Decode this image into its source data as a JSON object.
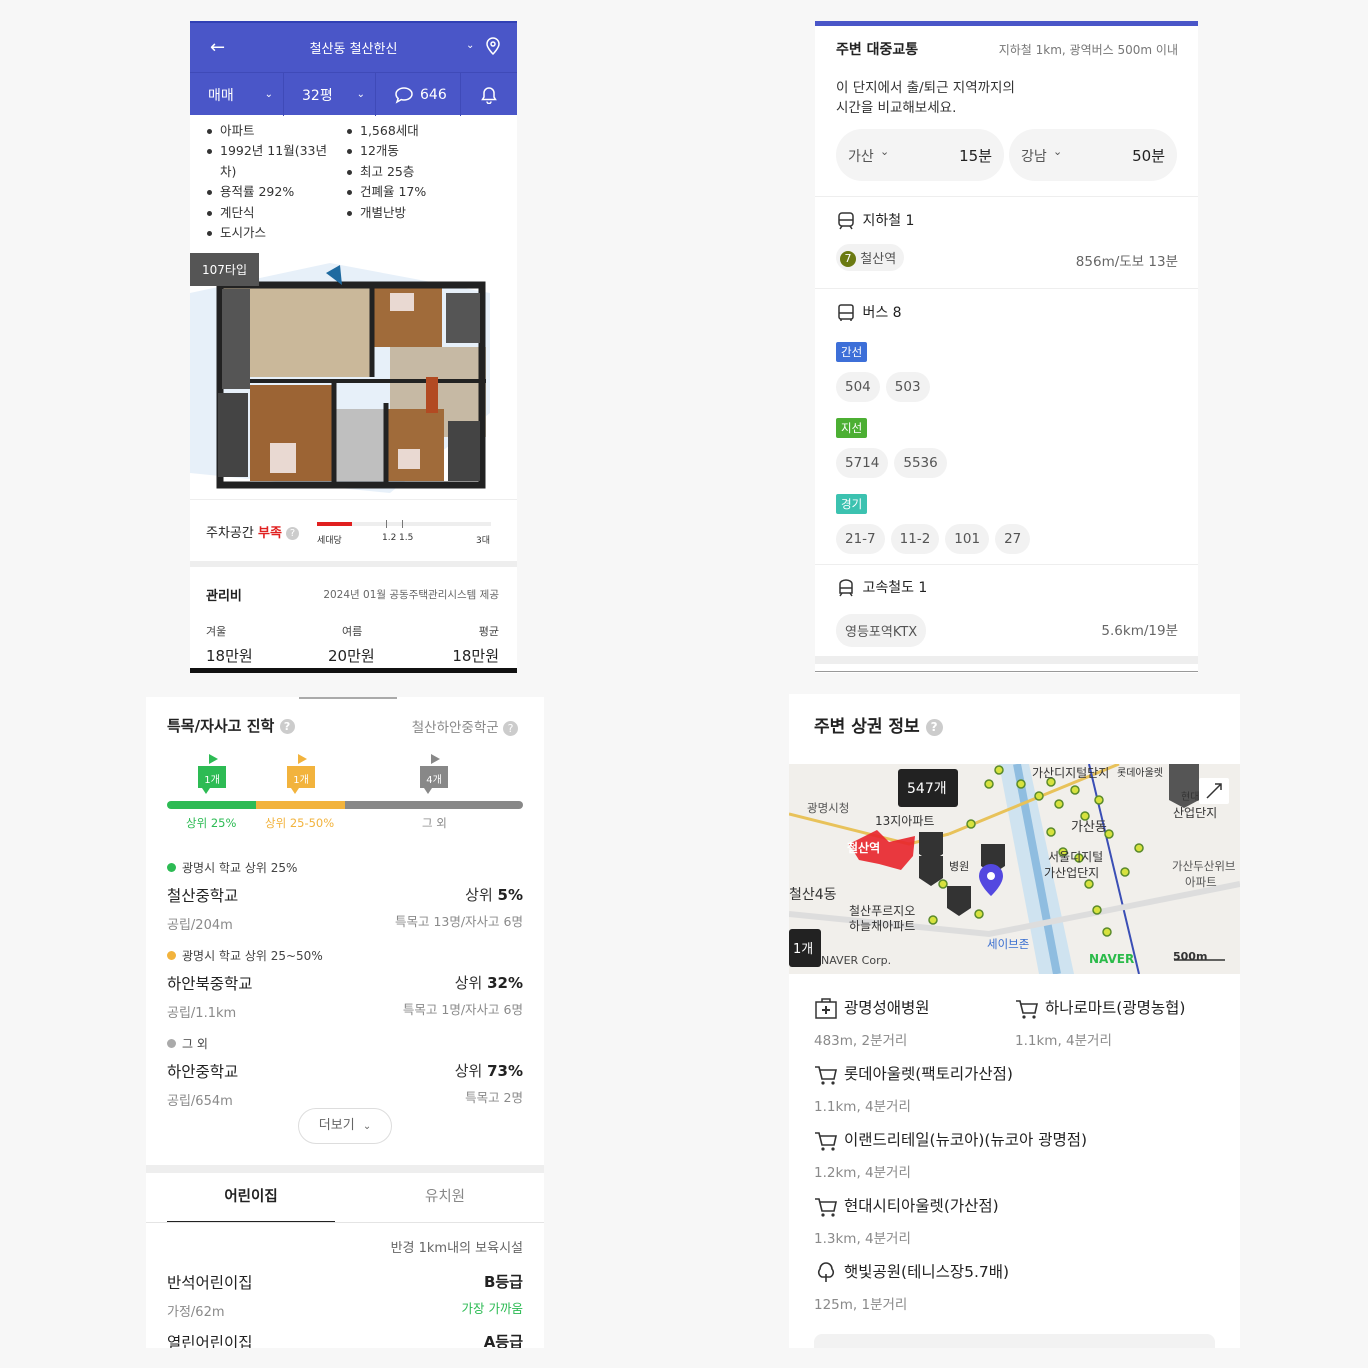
{
  "apt": {
    "title": "철산동 철산한신",
    "trade_type": "매매",
    "size": "32평",
    "comments": "646",
    "facts_left": [
      "아파트",
      "1992년 11월(33년 차)",
      "용적률 292%",
      "계단식",
      "도시가스"
    ],
    "facts_right": [
      "1,568세대",
      "12개동",
      "최고 25층",
      "건폐율 17%",
      "개별난방"
    ],
    "floorplan_type": "107타입",
    "parking": {
      "label": "주차공간",
      "status": "부족",
      "level": 0.12,
      "ticks": [
        "세대당",
        "1.2",
        "1.5",
        "3대"
      ],
      "status_color": "#e02020"
    },
    "mgmt": {
      "title": "관리비",
      "source": "2024년 01월 공동주택관리시스템 제공",
      "cols": [
        {
          "label": "겨울",
          "value": "18만원"
        },
        {
          "label": "여름",
          "value": "20만원"
        },
        {
          "label": "평균",
          "value": "18만원"
        }
      ]
    }
  },
  "school": {
    "title": "특목/자사고 진학",
    "district": "철산하안중학군",
    "flags": [
      {
        "count": "1개",
        "label": "상위 25%",
        "color": "#2dbb54"
      },
      {
        "count": "1개",
        "label": "상위 25-50%",
        "color": "#f2b33d"
      },
      {
        "count": "4개",
        "label": "그 외",
        "color": "#888888"
      }
    ],
    "groups": [
      {
        "header": "광명시 학교 상위 25%",
        "dot": "#2dbb54",
        "name": "철산중학교",
        "sub": "공립/204m",
        "rank_prefix": "상위 ",
        "rank": "5%",
        "stats": "특목고 13명/자사고 6명"
      },
      {
        "header": "광명시 학교 상위 25~50%",
        "dot": "#f2b33d",
        "name": "하안북중학교",
        "sub": "공립/1.1km",
        "rank_prefix": "상위 ",
        "rank": "32%",
        "stats": "특목고 1명/자사고 6명"
      },
      {
        "header": "그 외",
        "dot": "#aaaaaa",
        "name": "하안중학교",
        "sub": "공립/654m",
        "rank_prefix": "상위 ",
        "rank": "73%",
        "stats": "특목고 2명"
      }
    ],
    "more": "더보기"
  },
  "childcare": {
    "tabs": [
      "어린이집",
      "유치원"
    ],
    "radius": "반경 1km내의 보육시설",
    "items": [
      {
        "name": "반석어린이집",
        "sub": "가정/62m",
        "grade": "B등급",
        "note": "가장 가까움"
      },
      {
        "name": "열린어린이집",
        "grade": "A등급"
      }
    ]
  },
  "transit": {
    "title": "주변 대중교통",
    "range": "지하철 1km, 광역버스 500m 이내",
    "commute_text": "이 단지에서 출/퇴근 지역까지의\n시간을 비교해보세요.",
    "commute": [
      {
        "place": "가산",
        "time": "15분"
      },
      {
        "place": "강남",
        "time": "50분"
      }
    ],
    "subway": {
      "title": "지하철 1",
      "line": "7",
      "line_color": "#6b7a12",
      "station": "철산역",
      "dist": "856m/도보 13분"
    },
    "bus": {
      "title": "버스 8",
      "groups": [
        {
          "label": "간선",
          "color": "#3d6fd8",
          "routes": [
            "504",
            "503"
          ]
        },
        {
          "label": "지선",
          "color": "#4caf33",
          "routes": [
            "5714",
            "5536"
          ]
        },
        {
          "label": "경기",
          "color": "#3cc2b0",
          "routes": [
            "21-7",
            "11-2",
            "101",
            "27"
          ]
        }
      ]
    },
    "rail": {
      "title": "고속철도 1",
      "station": "영등포역KTX",
      "dist": "5.6km/19분"
    }
  },
  "commercial": {
    "title": "주변 상권 정보",
    "map": {
      "count": "547개",
      "labels": [
        "광명시청",
        "가산디지털단지",
        "가산동",
        "서울디지털",
        "가산업단지",
        "철산역",
        "철산4동",
        "철산푸르지오",
        "하늘채아파트",
        "세이브존",
        "가산두산위브",
        "아파트",
        "1개",
        "NAVER Corp.",
        "500m",
        "NAVER",
        "현대",
        "산업단지",
        "롯데아울렛",
        "13지아파트",
        "병원"
      ]
    },
    "pois": [
      {
        "icon": "hospital-icon",
        "name": "광명성애병원",
        "dist": "483m, 2분거리"
      },
      {
        "icon": "cart-icon",
        "name": "하나로마트(광명농협)",
        "dist": "1.1km, 4분거리"
      },
      {
        "icon": "cart-icon",
        "name": "롯데아울렛(팩토리가산점)",
        "dist": "1.1km, 4분거리"
      },
      {
        "icon": "cart-icon",
        "name": "이랜드리테일(뉴코아)(뉴코아 광명점)",
        "dist": "1.2km, 4분거리"
      },
      {
        "icon": "cart-icon",
        "name": "현대시티아울렛(가산점)",
        "dist": "1.3km, 4분거리"
      },
      {
        "icon": "tree-icon",
        "name": "햇빛공원(테니스장5.7배)",
        "dist": "125m, 1분거리"
      }
    ]
  }
}
